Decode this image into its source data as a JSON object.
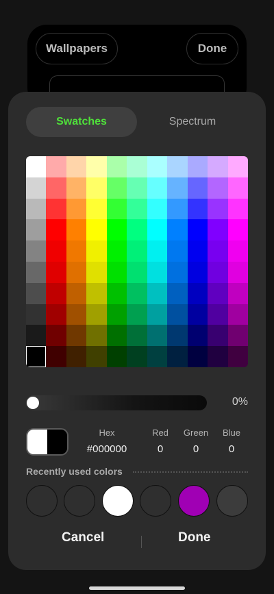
{
  "background": {
    "wallpapers_label": "Wallpapers",
    "done_label": "Done"
  },
  "tabs": [
    {
      "label": "Swatches",
      "selected": true
    },
    {
      "label": "Spectrum",
      "selected": false
    }
  ],
  "palette": [
    [
      "#ffffff",
      "#ffaaaa",
      "#ffd5aa",
      "#ffffaa",
      "#aaffaa",
      "#aaffd5",
      "#aaffff",
      "#aad5ff",
      "#aaaaff",
      "#d5aaff",
      "#ffaaff"
    ],
    [
      "#d4d4d4",
      "#ff6666",
      "#ffb366",
      "#ffff66",
      "#66ff66",
      "#66ffb3",
      "#66ffff",
      "#66b3ff",
      "#6666ff",
      "#b366ff",
      "#ff66ff"
    ],
    [
      "#b9b9b9",
      "#ff3333",
      "#ff9933",
      "#ffff33",
      "#33ff33",
      "#33ff99",
      "#33ffff",
      "#3399ff",
      "#3333ff",
      "#9933ff",
      "#ff33ff"
    ],
    [
      "#9e9e9e",
      "#ff0000",
      "#ff8000",
      "#ffff00",
      "#00ff00",
      "#00ff80",
      "#00ffff",
      "#0080ff",
      "#0000ff",
      "#8000ff",
      "#ff00ff"
    ],
    [
      "#838383",
      "#f00000",
      "#f07800",
      "#f0f000",
      "#00f000",
      "#00f078",
      "#00f0f0",
      "#0078f0",
      "#0000f0",
      "#7800f0",
      "#f000f0"
    ],
    [
      "#686868",
      "#e00000",
      "#e07000",
      "#e0e000",
      "#00e000",
      "#00e070",
      "#00e0e0",
      "#0070e0",
      "#0000e0",
      "#7000e0",
      "#e000e0"
    ],
    [
      "#4d4d4d",
      "#c00000",
      "#c06000",
      "#c0c000",
      "#00c000",
      "#00c060",
      "#00c0c0",
      "#0060c0",
      "#0000c0",
      "#6000c0",
      "#c000c0"
    ],
    [
      "#323232",
      "#a00000",
      "#a05000",
      "#a0a000",
      "#00a000",
      "#00a050",
      "#00a0a0",
      "#0050a0",
      "#0000a0",
      "#5000a0",
      "#a000a0"
    ],
    [
      "#1a1a1a",
      "#700000",
      "#703800",
      "#707000",
      "#007000",
      "#007038",
      "#007070",
      "#003870",
      "#000070",
      "#380070",
      "#700070"
    ],
    [
      "#000000",
      "#400000",
      "#402000",
      "#404000",
      "#004000",
      "#004020",
      "#004040",
      "#002040",
      "#000040",
      "#200040",
      "#400040"
    ]
  ],
  "selected_swatch": {
    "row": 9,
    "col": 0
  },
  "opacity": {
    "value": 0,
    "label": "0%"
  },
  "color": {
    "hex_label": "Hex",
    "hex_value": "#000000",
    "red_label": "Red",
    "red_value": "0",
    "green_label": "Green",
    "green_value": "0",
    "blue_label": "Blue",
    "blue_value": "0"
  },
  "recent": {
    "label": "Recently used colors",
    "colors": [
      "#2f2f2f",
      "#2f2f2f",
      "#ffffff",
      "#2f2f2f",
      "#a000b4",
      "#3c3c3c"
    ]
  },
  "actions": {
    "cancel_label": "Cancel",
    "done_label": "Done"
  }
}
